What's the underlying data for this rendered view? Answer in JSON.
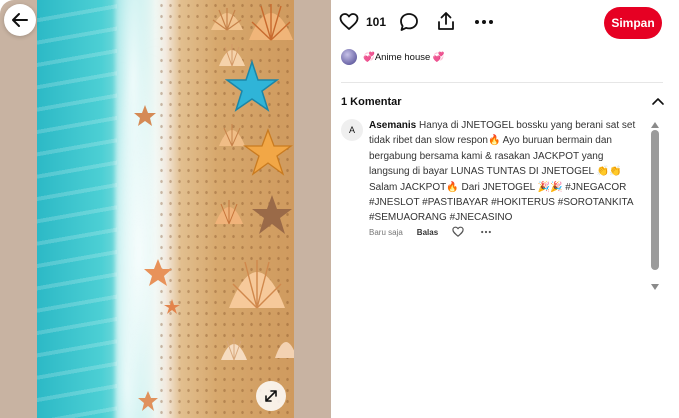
{
  "pin": {
    "image_icons": {
      "back": "arrow-left-icon",
      "expand": "expand-diagonal-icon"
    }
  },
  "actions": {
    "like_count": "101",
    "save_label": "Simpan",
    "icons": {
      "like": "heart-icon",
      "comment": "speech-bubble-icon",
      "share": "share-icon",
      "more": "ellipsis-icon"
    }
  },
  "board": {
    "name": "💞Anime house 💞"
  },
  "comments": {
    "title": "1 Komentar",
    "items": [
      {
        "avatar_letter": "A",
        "author": "Asemanis",
        "text": "Hanya di JNETOGEL bossku yang berani sat set tidak ribet dan slow respon🔥 Ayo buruan bermain dan bergabung bersama kami & rasakan JACKPOT yang langsung di bayar LUNAS TUNTAS DI JNETOGEL 👏👏 Salam JACKPOT🔥 Dari JNETOGEL 🎉🎉 #JNEGACOR #JNESLOT #PASTIBAYAR #HOKITERUS #SOROTANKITA #SEMUAORANG #JNECASINO",
        "time": "Baru saja",
        "reply_label": "Balas"
      }
    ]
  },
  "colors": {
    "save": "#e60023",
    "scrollbar": "#9b9b9b",
    "image_side": "#c8b3a2"
  }
}
